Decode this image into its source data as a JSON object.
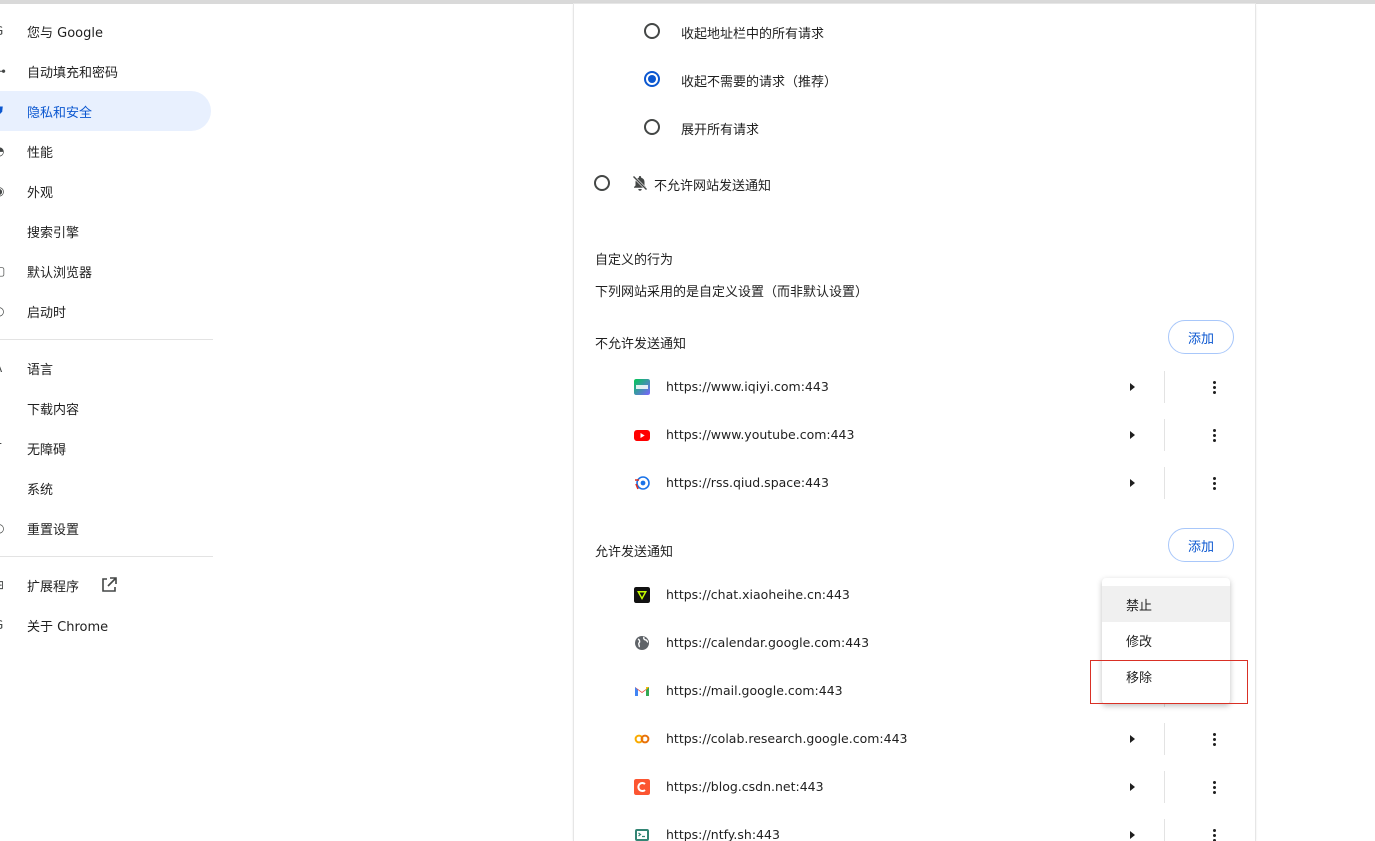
{
  "sidebar": {
    "items": [
      {
        "label": "您与 Google",
        "icon": "google-g-icon"
      },
      {
        "label": "自动填充和密码",
        "icon": "key-icon"
      },
      {
        "label": "隐私和安全",
        "icon": "shield-icon"
      },
      {
        "label": "性能",
        "icon": "speedometer-icon"
      },
      {
        "label": "外观",
        "icon": "palette-icon"
      },
      {
        "label": "搜索引擎",
        "icon": "search-icon"
      },
      {
        "label": "默认浏览器",
        "icon": "browser-icon"
      },
      {
        "label": "启动时",
        "icon": "power-icon"
      }
    ],
    "items2": [
      {
        "label": "语言",
        "icon": "translate-icon"
      },
      {
        "label": "下载内容",
        "icon": "download-icon"
      },
      {
        "label": "无障碍",
        "icon": "accessibility-icon"
      },
      {
        "label": "系统",
        "icon": "wrench-icon"
      },
      {
        "label": "重置设置",
        "icon": "reset-icon"
      }
    ],
    "items3": [
      {
        "label": "扩展程序",
        "icon": "puzzle-icon"
      },
      {
        "label": "关于 Chrome",
        "icon": "chrome-icon"
      }
    ]
  },
  "main": {
    "quiet_options": [
      {
        "label": "收起地址栏中的所有请求",
        "checked": false
      },
      {
        "label": "收起不需要的请求（推荐）",
        "checked": true
      },
      {
        "label": "展开所有请求",
        "checked": false
      }
    ],
    "block_option": "不允许网站发送通知",
    "custom_title": "自定义的行为",
    "custom_desc": "下列网站采用的是自定义设置（而非默认设置）",
    "blocked_title": "不允许发送通知",
    "allowed_title": "允许发送通知",
    "add_label": "添加",
    "blocked_sites": [
      {
        "url": "https://www.iqiyi.com:443",
        "favicon": "iqiyi-icon"
      },
      {
        "url": "https://www.youtube.com:443",
        "favicon": "youtube-icon"
      },
      {
        "url": "https://rss.qiud.space:443",
        "favicon": "rss-icon"
      }
    ],
    "allowed_sites": [
      {
        "url": "https://chat.xiaoheihe.cn:443",
        "favicon": "xiaoheihe-icon"
      },
      {
        "url": "https://calendar.google.com:443",
        "favicon": "globe-icon"
      },
      {
        "url": "https://mail.google.com:443",
        "favicon": "gmail-icon"
      },
      {
        "url": "https://colab.research.google.com:443",
        "favicon": "colab-icon"
      },
      {
        "url": "https://blog.csdn.net:443",
        "favicon": "csdn-icon"
      },
      {
        "url": "https://ntfy.sh:443",
        "favicon": "ntfy-icon"
      }
    ]
  },
  "menu": {
    "items": [
      "禁止",
      "修改",
      "移除"
    ]
  },
  "colors": {
    "accent": "#0b57d0",
    "active_bg": "#e8f0fe",
    "highlight": "#d93025"
  }
}
